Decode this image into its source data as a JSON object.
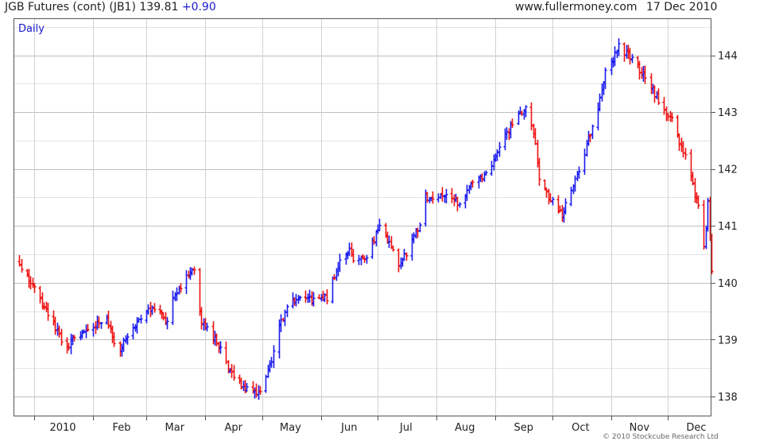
{
  "header": {
    "instrument": "JGB Futures (cont) (JB1)",
    "last": "139.81",
    "change": "+0.90",
    "site": "www.fullermoney.com",
    "date": "17 Dec 2010"
  },
  "footer": {
    "copyright": "© 2010 Stockcube Research Ltd"
  },
  "colors": {
    "up": "#1a1aee",
    "down": "#ee1111",
    "grid": "#d2d2d2",
    "frame": "#555555",
    "label_blue": "#1a1acc"
  },
  "chart_data": {
    "type": "ohlc",
    "title": "",
    "period_label": "Daily",
    "xlabel": "",
    "ylabel": "",
    "ylim": [
      137.65,
      144.65
    ],
    "yticks": [
      138,
      139,
      140,
      141,
      142,
      143,
      144
    ],
    "y_minor_step": 0.5,
    "x_months": [
      "2010",
      "Feb",
      "Mar",
      "Apr",
      "May",
      "Jun",
      "Jul",
      "Aug",
      "Sep",
      "Oct",
      "Nov",
      "Dec"
    ],
    "x_range": [
      "2009-12-21",
      "2010-12-24"
    ],
    "grid": true,
    "y_axis_side": "right",
    "series": [
      {
        "points": [
          [
            "2009-12-24",
            140.3
          ],
          [
            "2009-12-31",
            139.95
          ],
          [
            "2010-01-07",
            139.5
          ],
          [
            "2010-01-14",
            139.1
          ],
          [
            "2010-01-18",
            138.8
          ],
          [
            "2010-01-21",
            139.0
          ],
          [
            "2010-01-28",
            139.15
          ],
          [
            "2010-02-04",
            139.3
          ],
          [
            "2010-02-08",
            139.45
          ],
          [
            "2010-02-11",
            139.0
          ],
          [
            "2010-02-15",
            138.85
          ],
          [
            "2010-02-22",
            139.25
          ],
          [
            "2010-03-01",
            139.55
          ],
          [
            "2010-03-05",
            139.5
          ],
          [
            "2010-03-12",
            139.35
          ],
          [
            "2010-03-15",
            139.8
          ],
          [
            "2010-03-19",
            139.95
          ],
          [
            "2010-03-26",
            140.25
          ],
          [
            "2010-03-30",
            139.35
          ],
          [
            "2010-04-06",
            139.0
          ],
          [
            "2010-04-09",
            138.85
          ],
          [
            "2010-04-12",
            138.55
          ],
          [
            "2010-04-16",
            138.3
          ],
          [
            "2010-04-23",
            138.1
          ],
          [
            "2010-04-30",
            138.05
          ],
          [
            "2010-05-07",
            138.75
          ],
          [
            "2010-05-10",
            139.2
          ],
          [
            "2010-05-14",
            139.6
          ],
          [
            "2010-05-21",
            139.75
          ],
          [
            "2010-05-28",
            139.7
          ],
          [
            "2010-06-04",
            139.75
          ],
          [
            "2010-06-11",
            140.4
          ],
          [
            "2010-06-16",
            140.6
          ],
          [
            "2010-06-18",
            140.4
          ],
          [
            "2010-06-25",
            140.45
          ],
          [
            "2010-07-02",
            141.0
          ],
          [
            "2010-07-09",
            140.55
          ],
          [
            "2010-07-12",
            140.35
          ],
          [
            "2010-07-16",
            140.5
          ],
          [
            "2010-07-23",
            141.05
          ],
          [
            "2010-07-26",
            141.5
          ],
          [
            "2010-07-30",
            141.5
          ],
          [
            "2010-08-06",
            141.5
          ],
          [
            "2010-08-13",
            141.4
          ],
          [
            "2010-08-20",
            141.8
          ],
          [
            "2010-08-27",
            141.9
          ],
          [
            "2010-09-03",
            142.4
          ],
          [
            "2010-09-10",
            142.8
          ],
          [
            "2010-09-17",
            143.05
          ],
          [
            "2010-09-22",
            142.5
          ],
          [
            "2010-09-24",
            141.8
          ],
          [
            "2010-10-01",
            141.4
          ],
          [
            "2010-10-06",
            141.2
          ],
          [
            "2010-10-08",
            141.4
          ],
          [
            "2010-10-15",
            142.0
          ],
          [
            "2010-10-22",
            142.7
          ],
          [
            "2010-10-29",
            143.7
          ],
          [
            "2010-11-05",
            144.15
          ],
          [
            "2010-11-12",
            143.95
          ],
          [
            "2010-11-19",
            143.6
          ],
          [
            "2010-11-26",
            143.2
          ],
          [
            "2010-12-03",
            142.85
          ],
          [
            "2010-12-10",
            142.2
          ],
          [
            "2010-12-17",
            141.3
          ],
          [
            "2010-12-20",
            140.6
          ],
          [
            "2010-12-22",
            141.4
          ],
          [
            "2010-12-24",
            140.2
          ]
        ]
      }
    ]
  }
}
